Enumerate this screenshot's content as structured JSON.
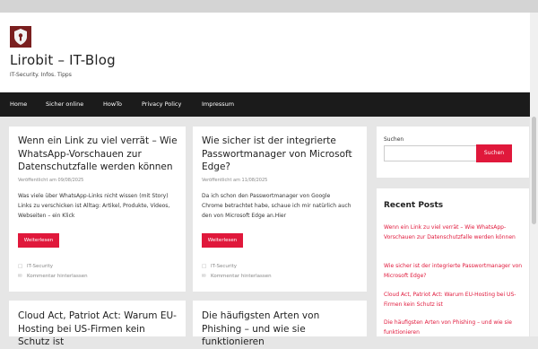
{
  "header": {
    "site_title": "Lirobit – IT-Blog",
    "site_description": "IT-Security. Infos. Tipps"
  },
  "nav": {
    "items": [
      {
        "label": "Home"
      },
      {
        "label": "Sicher online"
      },
      {
        "label": "HowTo"
      },
      {
        "label": "Privacy Policy"
      },
      {
        "label": "Impressum"
      }
    ]
  },
  "posts": [
    {
      "title": "Wenn ein Link zu viel verrät – Wie WhatsApp-Vorschauen zur Datenschutzfalle werden können",
      "meta": "Veröffentlicht am 09/08/2025",
      "excerpt": "Was viele über WhatsApp-Links nicht wissen (mit Story) Links zu verschicken ist Alltag: Artikel, Produkte, Videos, Webseiten – ein Klick",
      "button": "Weiterlesen",
      "category": "IT-Security",
      "comment": "Kommentar hinterlassen"
    },
    {
      "title": "Wie sicher ist der integrierte Passwortmanager von Microsoft Edge?",
      "meta": "Veröffentlicht am 11/08/2025",
      "excerpt": "Da ich schon den Passwortmanager von Google Chrome betrachtet habe, schaue ich mir natürlich auch den von Microsoft Edge an.Hier",
      "button": "Weiterlesen",
      "category": "IT-Security",
      "comment": "Kommentar hinterlassen"
    },
    {
      "title": "Cloud Act, Patriot Act: Warum EU-Hosting bei US-Firmen kein Schutz ist"
    },
    {
      "title": "Die häufigsten Arten von Phishing – und wie sie funktionieren"
    }
  ],
  "sidebar": {
    "search_label": "Suchen",
    "search_button": "Suchen",
    "recent_title": "Recent Posts",
    "recent": [
      "Wenn ein Link zu viel verrät – Wie WhatsApp-Vorschauen zur Datenschutzfalle werden können",
      "Wie sicher ist der integrierte Passwortmanager von Microsoft Edge?",
      "Cloud Act, Patriot Act: Warum EU-Hosting bei US-Firmen kein Schutz ist",
      "Die häufigsten Arten von Phishing – und wie sie funktionieren"
    ]
  },
  "colors": {
    "accent": "#e0183b",
    "nav_bg": "#1b1b1b",
    "page_bg": "#e6e6e6"
  },
  "icons": {
    "logo": "keyhole-shield-logo",
    "category": "folder-icon",
    "comment": "comment-icon"
  }
}
